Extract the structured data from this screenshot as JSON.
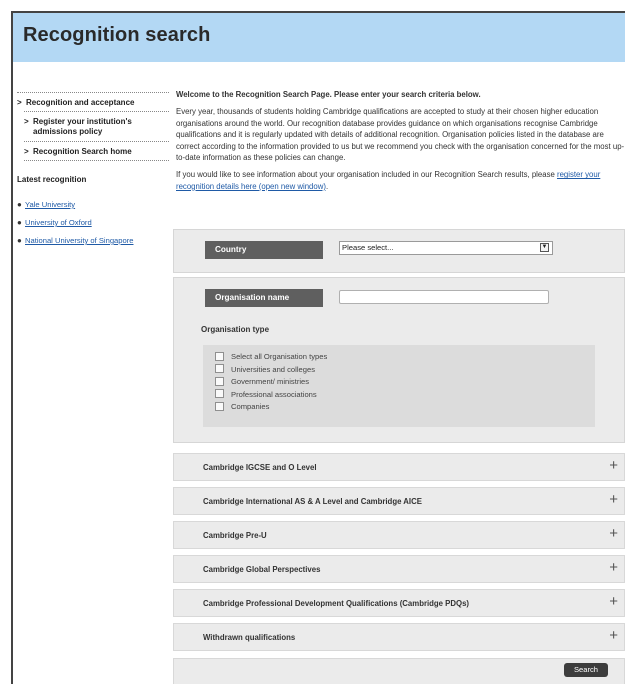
{
  "header": {
    "title": "Recognition search"
  },
  "sidebar": {
    "items": [
      {
        "label": "Recognition and acceptance"
      },
      {
        "label": "Register your institution's admissions policy"
      },
      {
        "label": "Recognition Search home"
      }
    ],
    "latest_heading": "Latest recognition",
    "latest_links": [
      "Yale University",
      "University of Oxford",
      "National University of Singapore"
    ]
  },
  "main": {
    "welcome": "Welcome to the Recognition Search Page. Please enter your search criteria below.",
    "intro": "Every year, thousands of students holding Cambridge qualifications are accepted to study at their chosen higher education organisations around the world. Our recognition database provides guidance on which organisations recognise Cambridge qualifications and it is regularly updated with details of additional recognition. Organisation policies listed in the database are correct according to the information provided to us but we recommend you check with the organisation concerned for the most up-to-date information as these policies can change.",
    "register_text": "If you would like to see information about your organisation included in our Recognition Search results, please",
    "register_link": "register your recognition details here (open new window)",
    "register_end": "."
  },
  "search": {
    "country_label": "Country",
    "country_value": "Please select...",
    "org_name_label": "Organisation name",
    "org_name_value": "",
    "org_type_label": "Organisation type",
    "org_types": [
      "Select all Organisation types",
      "Universities and colleges",
      "Government/ ministries",
      "Professional associations",
      "Companies"
    ],
    "search_button": "Search"
  },
  "accordions": [
    "Cambridge IGCSE and O Level",
    "Cambridge International AS & A Level and Cambridge AICE",
    "Cambridge Pre-U",
    "Cambridge Global Perspectives",
    "Cambridge Professional Development Qualifications (Cambridge PDQs)",
    "Withdrawn qualifications"
  ],
  "icons": {
    "expand": "plus-icon",
    "dropdown": "dropdown-arrow-icon",
    "bullet": "bullet-icon"
  }
}
